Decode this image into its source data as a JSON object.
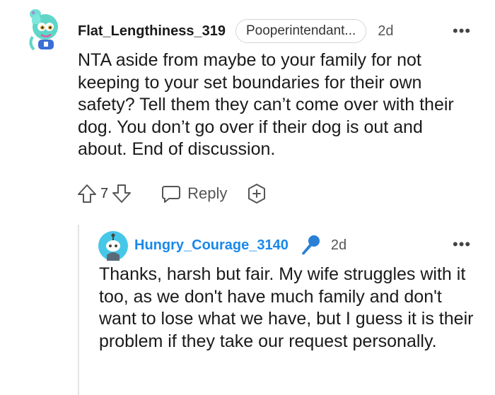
{
  "comment": {
    "username": "Flat_Lengthiness_319",
    "flair": "Pooperintendant...",
    "time": "2d",
    "more": "•••",
    "body": "NTA aside from maybe to your family for not keeping to your set boundaries for their own safety? Tell them they can’t come over with their dog. You don’t go over if their dog is out and about. End of discussion.",
    "vote_count": "7",
    "reply_label": "Reply"
  },
  "reply": {
    "username": "Hungry_Courage_3140",
    "time": "2d",
    "more": "•••",
    "body": "Thanks, harsh but fair. My wife struggles with it too, as we don't have much family and don't want to lose what we have, but I guess it is their problem if they take our request personally."
  },
  "colors": {
    "username_reply": "#1a88ea",
    "mic_icon": "#2a7fd6",
    "avatar1_primary": "#5fd6c8",
    "avatar2_bg": "#46c7e8"
  },
  "icons": [
    "upvote-icon",
    "downvote-icon",
    "reply-bubble-icon",
    "award-plus-icon",
    "microphone-icon",
    "more-options-icon"
  ]
}
